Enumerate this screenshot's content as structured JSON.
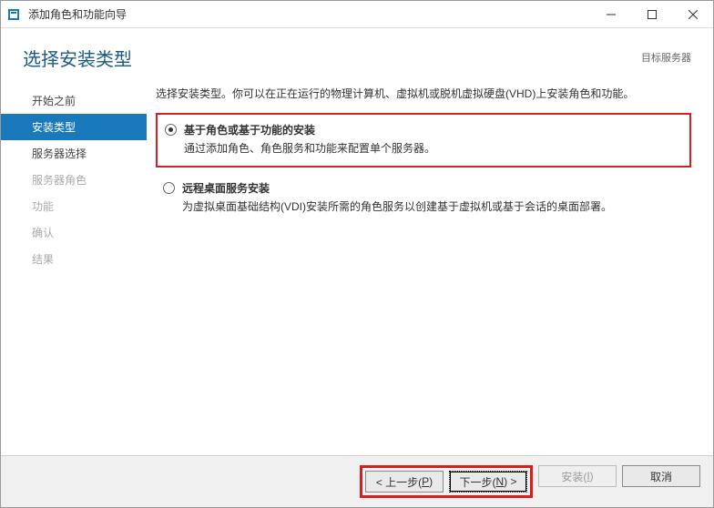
{
  "window": {
    "title": "添加角色和功能向导"
  },
  "header": {
    "page_title": "选择安装类型",
    "target_server_label": "目标服务器"
  },
  "sidebar": {
    "items": [
      {
        "label": "开始之前",
        "state": "enabled"
      },
      {
        "label": "安装类型",
        "state": "selected"
      },
      {
        "label": "服务器选择",
        "state": "enabled"
      },
      {
        "label": "服务器角色",
        "state": "disabled"
      },
      {
        "label": "功能",
        "state": "disabled"
      },
      {
        "label": "确认",
        "state": "disabled"
      },
      {
        "label": "结果",
        "state": "disabled"
      }
    ]
  },
  "content": {
    "intro": "选择安装类型。你可以在正在运行的物理计算机、虚拟机或脱机虚拟硬盘(VHD)上安装角色和功能。",
    "options": [
      {
        "title": "基于角色或基于功能的安装",
        "desc": "通过添加角色、角色服务和功能来配置单个服务器。",
        "checked": true,
        "highlighted": true
      },
      {
        "title": "远程桌面服务安装",
        "desc": "为虚拟桌面基础结构(VDI)安装所需的角色服务以创建基于虚拟机或基于会话的桌面部署。",
        "checked": false,
        "highlighted": false
      }
    ]
  },
  "footer": {
    "prev": "< 上一步(",
    "prev_mn": "P",
    "prev_suffix": ")",
    "next": "下一步(",
    "next_mn": "N",
    "next_suffix": ") >",
    "install": "安装(",
    "install_mn": "I",
    "install_suffix": ")",
    "cancel": "取消"
  }
}
